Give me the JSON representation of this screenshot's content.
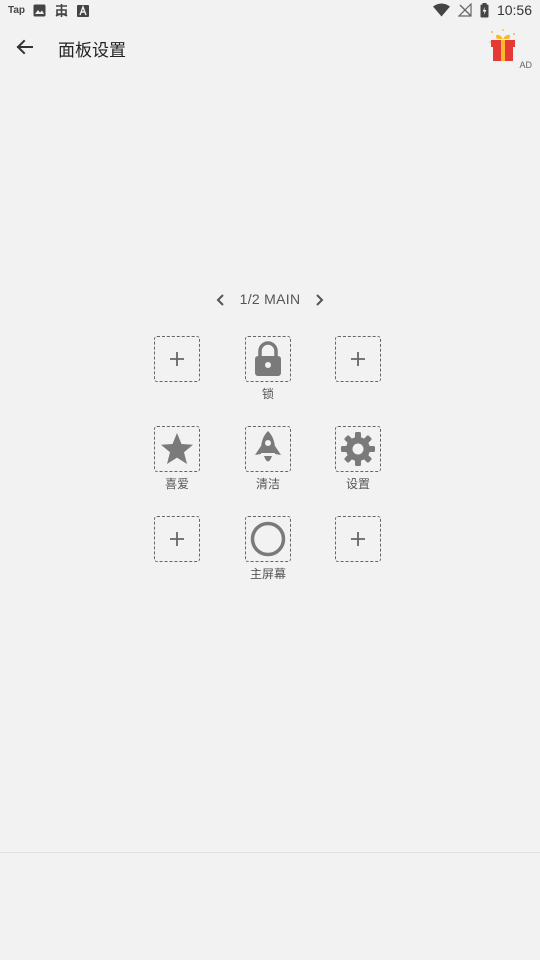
{
  "status_bar": {
    "tap_label": "Tap",
    "time": "10:56",
    "left_icons": [
      "tap-icon",
      "image-icon",
      "bug-icon",
      "font-a-icon"
    ],
    "right_icons": [
      "wifi-icon",
      "no-signal-icon",
      "battery-icon"
    ]
  },
  "header": {
    "title": "面板设置",
    "ad_label": "AD"
  },
  "pager": {
    "label": "1/2 MAIN"
  },
  "grid": {
    "slots": [
      {
        "label": "",
        "icon": "plus-icon"
      },
      {
        "label": "锁",
        "icon": "lock-icon"
      },
      {
        "label": "",
        "icon": "plus-icon"
      },
      {
        "label": "喜爱",
        "icon": "star-icon"
      },
      {
        "label": "清洁",
        "icon": "rocket-icon"
      },
      {
        "label": "设置",
        "icon": "gear-icon"
      },
      {
        "label": "",
        "icon": "plus-icon"
      },
      {
        "label": "主屏幕",
        "icon": "home-circle-icon"
      },
      {
        "label": "",
        "icon": "plus-icon"
      }
    ]
  },
  "colors": {
    "background": "#f2f2f2",
    "icon_gray": "#7a7a7a",
    "gift_red": "#e53935",
    "gift_gold": "#f9b92b"
  }
}
